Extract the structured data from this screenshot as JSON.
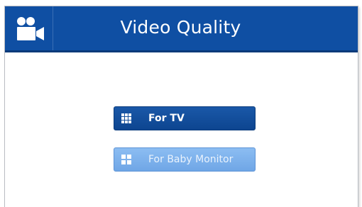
{
  "header": {
    "title": "Video Quality",
    "icon": "video-camera-icon",
    "background_color": "#0f4fa3"
  },
  "options": [
    {
      "label": "For TV",
      "icon": "grid-9-icon",
      "selected": true,
      "color": "#0d4590"
    },
    {
      "label": "For Baby Monitor",
      "icon": "grid-4-icon",
      "selected": false,
      "color": "#7db1ec"
    }
  ]
}
